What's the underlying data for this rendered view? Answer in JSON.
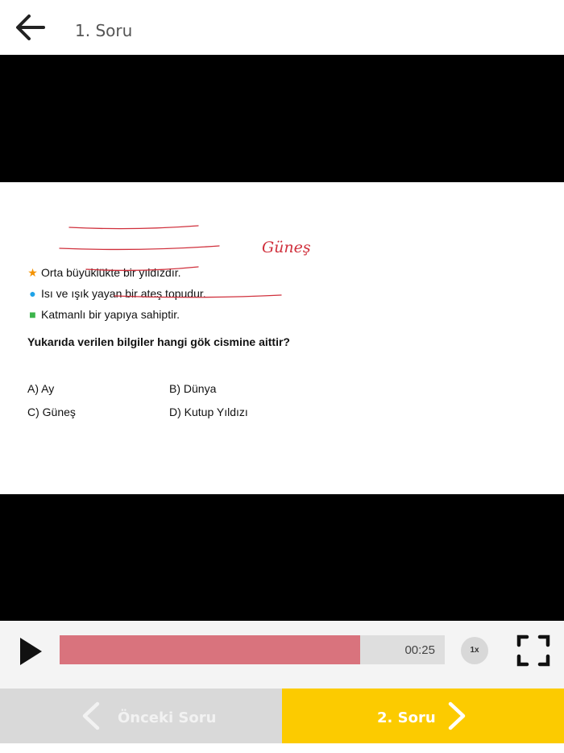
{
  "header": {
    "title": "1. Soru",
    "back_icon": "arrow-left-icon"
  },
  "slide": {
    "facts": [
      {
        "marker": "★",
        "marker_color": "#f39200",
        "text": "Orta büyüklükte bir yıldızdır."
      },
      {
        "marker": "●",
        "marker_color": "#1fa3e8",
        "text": "Isı ve ışık yayan bir ateş topudur."
      },
      {
        "marker": "■",
        "marker_color": "#3cb44b",
        "text": "Katmanlı bir yapıya sahiptir."
      }
    ],
    "question": "Yukarıda verilen bilgiler hangi gök cismine aittir?",
    "options": [
      "A) Ay",
      "B) Dünya",
      "C) Güneş",
      "D) Kutup Yıldızı"
    ],
    "handwritten_note": "Güneş",
    "annotation_color": "#d0303c"
  },
  "player": {
    "progress": 0.78,
    "time": "00:25",
    "speed": "1x",
    "progress_color": "#d9737d"
  },
  "nav": {
    "prev_label": "Önceki Soru",
    "next_label": "2. Soru",
    "next_color": "#fccb00"
  }
}
